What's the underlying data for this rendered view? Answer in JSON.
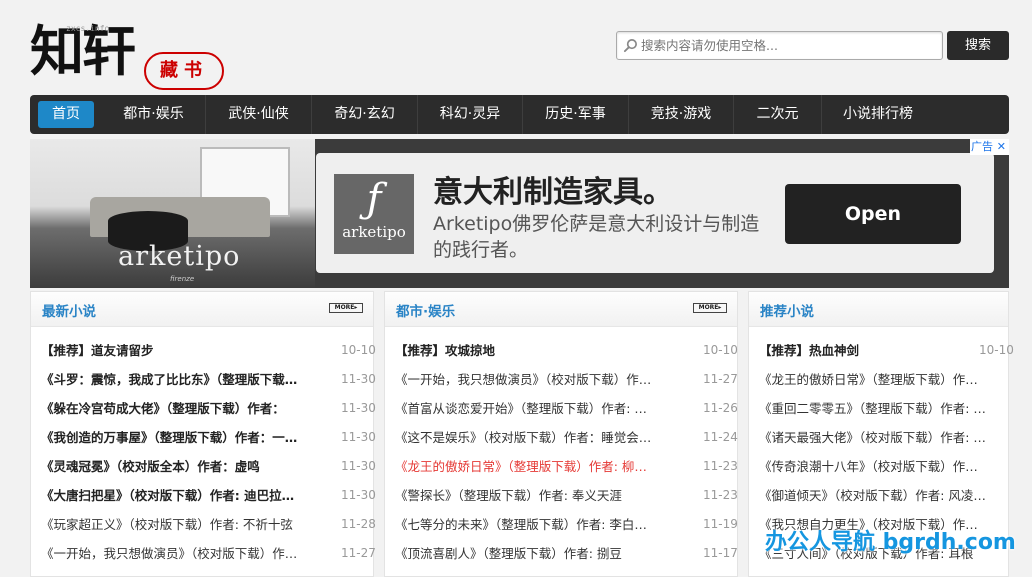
{
  "logo": {
    "main": "知轩",
    "seal": "藏书",
    "small": "zxcs.info"
  },
  "search": {
    "placeholder": "搜索内容请勿使用空格...",
    "button": "搜索"
  },
  "nav": [
    "首页",
    "都市·娱乐",
    "武侠·仙侠",
    "奇幻·玄幻",
    "科幻·灵异",
    "历史·军事",
    "竞技·游戏",
    "二次元",
    "小说排行榜"
  ],
  "ad": {
    "brand": "arketipo",
    "brand_sub": "firenze",
    "logo_glyph": "ƒ",
    "logo_name": "arketipo",
    "headline": "意大利制造家具。",
    "description": "Arketipo佛罗伦萨是意大利设计与制造的践行者。",
    "cta": "Open",
    "tag": "广告",
    "close": "✕"
  },
  "more_label": "MORE▸",
  "columns": [
    {
      "title": "最新小说",
      "rows": [
        {
          "title": "【推荐】道友请留步",
          "date": "10-10",
          "style": "bold"
        },
        {
          "title": "《斗罗：震惊，我成了比比东》（整理版下载）作者：…",
          "date": "11-30",
          "style": "bold"
        },
        {
          "title": "《躲在冷宫苟成大佬》（整理版下载）作者：",
          "date": "11-30",
          "style": "bold"
        },
        {
          "title": "《我创造的万事屋》（整理版下载）作者：一…",
          "date": "11-30",
          "style": "bold"
        },
        {
          "title": "《灵魂冠冕》（校对版全本）作者：虚鸣",
          "date": "11-30",
          "style": "bold"
        },
        {
          "title": "《大唐扫把星》（校对版下载）作者: 迪巴拉…",
          "date": "11-30",
          "style": "bold"
        },
        {
          "title": "《玩家超正义》（校对版下载）作者: 不祈十弦",
          "date": "11-28",
          "style": ""
        },
        {
          "title": "《一开始，我只想做演员》（校对版下载）作…",
          "date": "11-27",
          "style": ""
        }
      ]
    },
    {
      "title": "都市·娱乐",
      "rows": [
        {
          "title": "【推荐】攻城掠地",
          "date": "10-10",
          "style": "bold"
        },
        {
          "title": "《一开始，我只想做演员》（校对版下载）作…",
          "date": "11-27",
          "style": ""
        },
        {
          "title": "《首富从谈恋爱开始》（整理版下载）作者: …",
          "date": "11-26",
          "style": ""
        },
        {
          "title": "《这不是娱乐》（校对版下载）作者：睡觉会…",
          "date": "11-24",
          "style": ""
        },
        {
          "title": "《龙王的傲娇日常》（整理版下载）作者: 柳…",
          "date": "11-23",
          "style": "red"
        },
        {
          "title": "《警探长》（整理版下载）作者: 奉义天涯",
          "date": "11-23",
          "style": ""
        },
        {
          "title": "《七等分的未来》（整理版下载）作者: 李白…",
          "date": "11-19",
          "style": ""
        },
        {
          "title": "《顶流喜剧人》（整理版下载）作者: 捌豆",
          "date": "11-17",
          "style": ""
        }
      ]
    },
    {
      "title": "推荐小说",
      "rows": [
        {
          "title": "【推荐】热血神剑",
          "date": "10-10",
          "style": "bold"
        },
        {
          "title": "《龙王的傲娇日常》（整理版下载）作…",
          "date": "",
          "style": ""
        },
        {
          "title": "《重回二零零五》（整理版下载）作者: …",
          "date": "",
          "style": ""
        },
        {
          "title": "《诸天最强大佬》（校对版下载）作者: …",
          "date": "",
          "style": ""
        },
        {
          "title": "《传奇浪潮十八年》（校对版下载）作…",
          "date": "",
          "style": ""
        },
        {
          "title": "《御道倾天》（校对版下载）作者: 风凌…",
          "date": "",
          "style": ""
        },
        {
          "title": "《我只想自力更生》（校对版下载）作…",
          "date": "",
          "style": ""
        },
        {
          "title": "《三寸人间》（校对版下载）作者: 耳根",
          "date": "",
          "style": ""
        }
      ]
    }
  ],
  "watermark": "办公人导航 bgrdh.com"
}
